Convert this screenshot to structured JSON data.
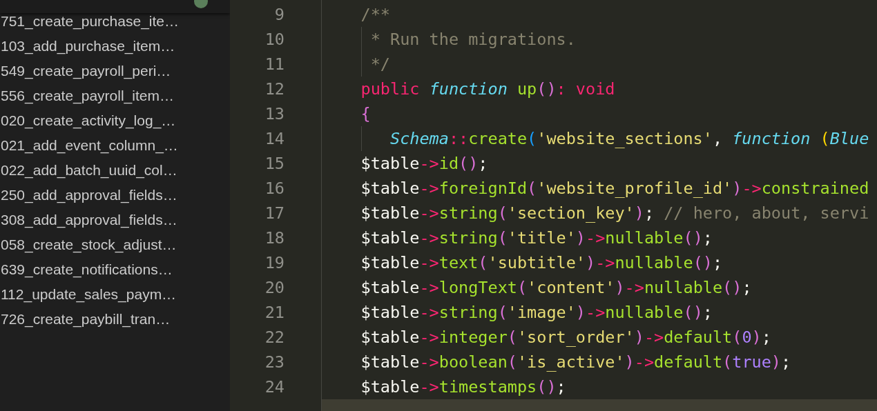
{
  "sidebar": {
    "files": [
      "751_create_purchase_ite…",
      "103_add_purchase_item…",
      "549_create_payroll_peri…",
      "556_create_payroll_item…",
      "020_create_activity_log_…",
      "021_add_event_column_…",
      "022_add_batch_uuid_col…",
      "250_add_approval_fields…",
      "308_add_approval_fields…",
      "058_create_stock_adjust…",
      "639_create_notifications…",
      "112_update_sales_paym…",
      "726_create_paybill_tran…"
    ]
  },
  "editor": {
    "lines": [
      {
        "number": "9",
        "kind": "block",
        "tokens": [
          {
            "kind": "comment",
            "text": "/**"
          }
        ]
      },
      {
        "number": "10",
        "kind": "comment",
        "tokens": [
          {
            "kind": "comment",
            "text": "* Run the migrations."
          }
        ]
      },
      {
        "number": "11",
        "kind": "comment",
        "tokens": [
          {
            "kind": "comment",
            "text": "*/"
          }
        ]
      },
      {
        "number": "12",
        "kind": "block",
        "tokens": [
          {
            "kind": "keyword",
            "text": "public "
          },
          {
            "kind": "storage",
            "text": "function "
          },
          {
            "kind": "func",
            "text": "up"
          },
          {
            "kind": "paren",
            "text": "()"
          },
          {
            "kind": "keyword",
            "text": ": void"
          }
        ]
      },
      {
        "number": "13",
        "kind": "block",
        "tokens": [
          {
            "kind": "paren",
            "text": "{"
          }
        ]
      },
      {
        "number": "14",
        "kind": "inner",
        "tokens": [
          {
            "kind": "class",
            "text": "Schema"
          },
          {
            "kind": "keyword",
            "text": "::"
          },
          {
            "kind": "func",
            "text": "create"
          },
          {
            "kind": "blue",
            "text": "("
          },
          {
            "kind": "string",
            "text": "'website_sections'"
          },
          {
            "kind": "plain",
            "text": ", "
          },
          {
            "kind": "storage",
            "text": "function "
          },
          {
            "kind": "gold",
            "text": "("
          },
          {
            "kind": "class",
            "text": "Blue"
          }
        ]
      },
      {
        "number": "15",
        "kind": "block",
        "tokens": [
          {
            "kind": "plain",
            "text": "$table"
          },
          {
            "kind": "keyword",
            "text": "->"
          },
          {
            "kind": "func",
            "text": "id"
          },
          {
            "kind": "paren",
            "text": "()"
          },
          {
            "kind": "plain",
            "text": ";"
          }
        ]
      },
      {
        "number": "16",
        "kind": "block",
        "tokens": [
          {
            "kind": "plain",
            "text": "$table"
          },
          {
            "kind": "keyword",
            "text": "->"
          },
          {
            "kind": "func",
            "text": "foreignId"
          },
          {
            "kind": "paren",
            "text": "("
          },
          {
            "kind": "string",
            "text": "'website_profile_id'"
          },
          {
            "kind": "paren",
            "text": ")"
          },
          {
            "kind": "keyword",
            "text": "->"
          },
          {
            "kind": "func",
            "text": "constrained"
          }
        ]
      },
      {
        "number": "17",
        "kind": "block",
        "tokens": [
          {
            "kind": "plain",
            "text": "$table"
          },
          {
            "kind": "keyword",
            "text": "->"
          },
          {
            "kind": "func",
            "text": "string"
          },
          {
            "kind": "paren",
            "text": "("
          },
          {
            "kind": "string",
            "text": "'section_key'"
          },
          {
            "kind": "paren",
            "text": ")"
          },
          {
            "kind": "plain",
            "text": "; "
          },
          {
            "kind": "comment",
            "text": "// hero, about, servi"
          }
        ]
      },
      {
        "number": "18",
        "kind": "block",
        "tokens": [
          {
            "kind": "plain",
            "text": "$table"
          },
          {
            "kind": "keyword",
            "text": "->"
          },
          {
            "kind": "func",
            "text": "string"
          },
          {
            "kind": "paren",
            "text": "("
          },
          {
            "kind": "string",
            "text": "'title'"
          },
          {
            "kind": "paren",
            "text": ")"
          },
          {
            "kind": "keyword",
            "text": "->"
          },
          {
            "kind": "func",
            "text": "nullable"
          },
          {
            "kind": "paren",
            "text": "()"
          },
          {
            "kind": "plain",
            "text": ";"
          }
        ]
      },
      {
        "number": "19",
        "kind": "block",
        "tokens": [
          {
            "kind": "plain",
            "text": "$table"
          },
          {
            "kind": "keyword",
            "text": "->"
          },
          {
            "kind": "func",
            "text": "text"
          },
          {
            "kind": "paren",
            "text": "("
          },
          {
            "kind": "string",
            "text": "'subtitle'"
          },
          {
            "kind": "paren",
            "text": ")"
          },
          {
            "kind": "keyword",
            "text": "->"
          },
          {
            "kind": "func",
            "text": "nullable"
          },
          {
            "kind": "paren",
            "text": "()"
          },
          {
            "kind": "plain",
            "text": ";"
          }
        ]
      },
      {
        "number": "20",
        "kind": "block",
        "tokens": [
          {
            "kind": "plain",
            "text": "$table"
          },
          {
            "kind": "keyword",
            "text": "->"
          },
          {
            "kind": "func",
            "text": "longText"
          },
          {
            "kind": "paren",
            "text": "("
          },
          {
            "kind": "string",
            "text": "'content'"
          },
          {
            "kind": "paren",
            "text": ")"
          },
          {
            "kind": "keyword",
            "text": "->"
          },
          {
            "kind": "func",
            "text": "nullable"
          },
          {
            "kind": "paren",
            "text": "()"
          },
          {
            "kind": "plain",
            "text": ";"
          }
        ]
      },
      {
        "number": "21",
        "kind": "block",
        "tokens": [
          {
            "kind": "plain",
            "text": "$table"
          },
          {
            "kind": "keyword",
            "text": "->"
          },
          {
            "kind": "func",
            "text": "string"
          },
          {
            "kind": "paren",
            "text": "("
          },
          {
            "kind": "string",
            "text": "'image'"
          },
          {
            "kind": "paren",
            "text": ")"
          },
          {
            "kind": "keyword",
            "text": "->"
          },
          {
            "kind": "func",
            "text": "nullable"
          },
          {
            "kind": "paren",
            "text": "()"
          },
          {
            "kind": "plain",
            "text": ";"
          }
        ]
      },
      {
        "number": "22",
        "kind": "block",
        "tokens": [
          {
            "kind": "plain",
            "text": "$table"
          },
          {
            "kind": "keyword",
            "text": "->"
          },
          {
            "kind": "func",
            "text": "integer"
          },
          {
            "kind": "paren",
            "text": "("
          },
          {
            "kind": "string",
            "text": "'sort_order'"
          },
          {
            "kind": "paren",
            "text": ")"
          },
          {
            "kind": "keyword",
            "text": "->"
          },
          {
            "kind": "func",
            "text": "default"
          },
          {
            "kind": "paren",
            "text": "("
          },
          {
            "kind": "number",
            "text": "0"
          },
          {
            "kind": "paren",
            "text": ")"
          },
          {
            "kind": "plain",
            "text": ";"
          }
        ]
      },
      {
        "number": "23",
        "kind": "block",
        "tokens": [
          {
            "kind": "plain",
            "text": "$table"
          },
          {
            "kind": "keyword",
            "text": "->"
          },
          {
            "kind": "func",
            "text": "boolean"
          },
          {
            "kind": "paren",
            "text": "("
          },
          {
            "kind": "string",
            "text": "'is_active'"
          },
          {
            "kind": "paren",
            "text": ")"
          },
          {
            "kind": "keyword",
            "text": "->"
          },
          {
            "kind": "func",
            "text": "default"
          },
          {
            "kind": "paren",
            "text": "("
          },
          {
            "kind": "number",
            "text": "true"
          },
          {
            "kind": "paren",
            "text": ")"
          },
          {
            "kind": "plain",
            "text": ";"
          }
        ]
      },
      {
        "number": "24",
        "kind": "block",
        "tokens": [
          {
            "kind": "plain",
            "text": "$table"
          },
          {
            "kind": "keyword",
            "text": "->"
          },
          {
            "kind": "func",
            "text": "timestamps"
          },
          {
            "kind": "paren",
            "text": "()"
          },
          {
            "kind": "plain",
            "text": ";"
          }
        ]
      }
    ]
  }
}
